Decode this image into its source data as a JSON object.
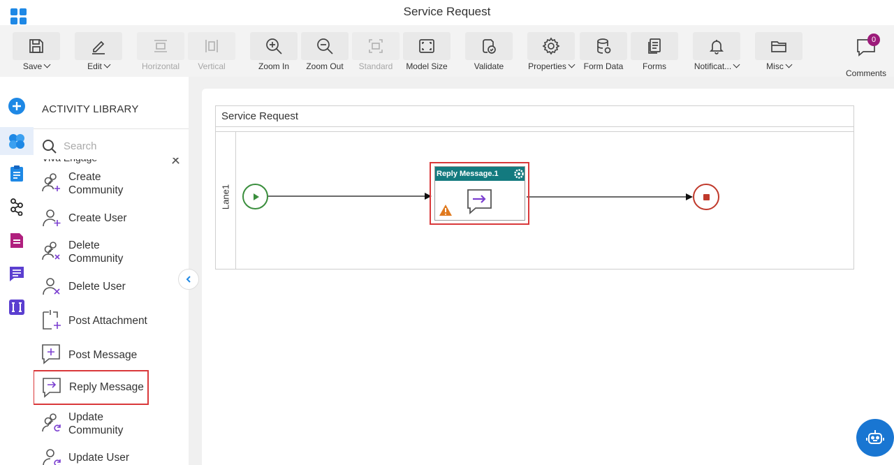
{
  "app": {
    "title": "Service Request"
  },
  "toolbar": {
    "save": "Save",
    "edit": "Edit",
    "horizontal": "Horizontal",
    "vertical": "Vertical",
    "zoom_in": "Zoom In",
    "zoom_out": "Zoom Out",
    "standard": "Standard",
    "model_size": "Model Size",
    "validate": "Validate",
    "properties": "Properties",
    "form_data": "Form Data",
    "forms": "Forms",
    "notifications": "Notificat...",
    "misc": "Misc",
    "comments": "Comments",
    "comments_count": "0"
  },
  "library": {
    "title": "ACTIVITY LIBRARY",
    "search_placeholder": "Search",
    "section": "Viva Engage",
    "items": [
      {
        "label": "Create\nCommunity",
        "icon": "user-plus-icon"
      },
      {
        "label": "Create User",
        "icon": "user-plus-icon"
      },
      {
        "label": "Delete\nCommunity",
        "icon": "user-delete-icon"
      },
      {
        "label": "Delete User",
        "icon": "user-delete-icon"
      },
      {
        "label": "Post Attachment",
        "icon": "attachment-plus-icon"
      },
      {
        "label": "Post Message",
        "icon": "message-plus-icon"
      },
      {
        "label": "Reply Message",
        "icon": "reply-message-icon"
      },
      {
        "label": "Update\nCommunity",
        "icon": "user-refresh-icon"
      },
      {
        "label": "Update User",
        "icon": "user-refresh-icon"
      }
    ]
  },
  "canvas": {
    "pool_title": "Service Request",
    "lane_label": "Lane1",
    "activity_title": "Reply Message.1"
  },
  "colors": {
    "accent": "#1e88e5",
    "activity_header": "#137a7f",
    "selection": "#d9383a",
    "start": "#3a8e3d",
    "end": "#c0392b",
    "badge": "#9c1b7a"
  }
}
